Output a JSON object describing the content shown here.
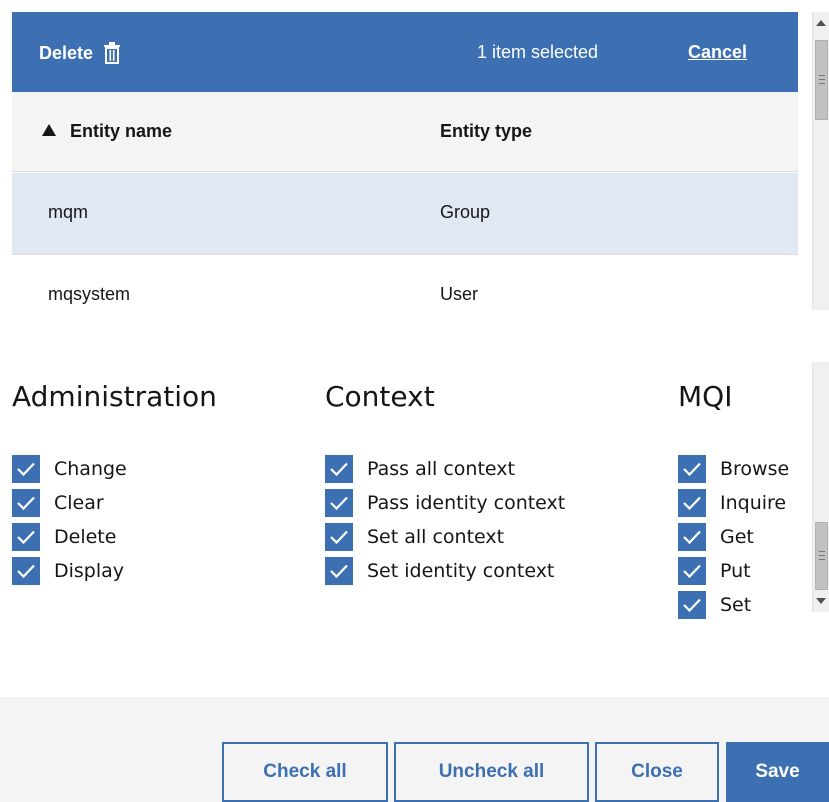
{
  "toolbar": {
    "delete_label": "Delete",
    "delete_icon": "trash-icon",
    "selection_text": "1 item selected",
    "cancel_label": "Cancel",
    "background": "#3d70b2"
  },
  "table": {
    "columns": [
      "Entity name",
      "Entity type"
    ],
    "sort": {
      "column": "Entity name",
      "direction": "ascending"
    },
    "rows": [
      {
        "name": "mqm",
        "type": "Group",
        "selected": true
      },
      {
        "name": "mqsystem",
        "type": "User",
        "selected": false
      }
    ]
  },
  "permissions": {
    "administration": {
      "title": "Administration",
      "items": [
        {
          "label": "Change",
          "checked": true
        },
        {
          "label": "Clear",
          "checked": true
        },
        {
          "label": "Delete",
          "checked": true
        },
        {
          "label": "Display",
          "checked": true
        }
      ]
    },
    "context": {
      "title": "Context",
      "items": [
        {
          "label": "Pass all context",
          "checked": true
        },
        {
          "label": "Pass identity context",
          "checked": true
        },
        {
          "label": "Set all context",
          "checked": true
        },
        {
          "label": "Set identity context",
          "checked": true
        }
      ]
    },
    "mqi": {
      "title": "MQI",
      "items": [
        {
          "label": "Browse",
          "checked": true
        },
        {
          "label": "Inquire",
          "checked": true
        },
        {
          "label": "Get",
          "checked": true
        },
        {
          "label": "Put",
          "checked": true
        },
        {
          "label": "Set",
          "checked": true
        }
      ]
    }
  },
  "footer": {
    "check_all": "Check all",
    "uncheck_all": "Uncheck all",
    "close": "Close",
    "save": "Save"
  },
  "colors": {
    "accent": "#3d70b2",
    "selected_row": "#dfe8f3",
    "header_bg": "#f4f4f4"
  }
}
